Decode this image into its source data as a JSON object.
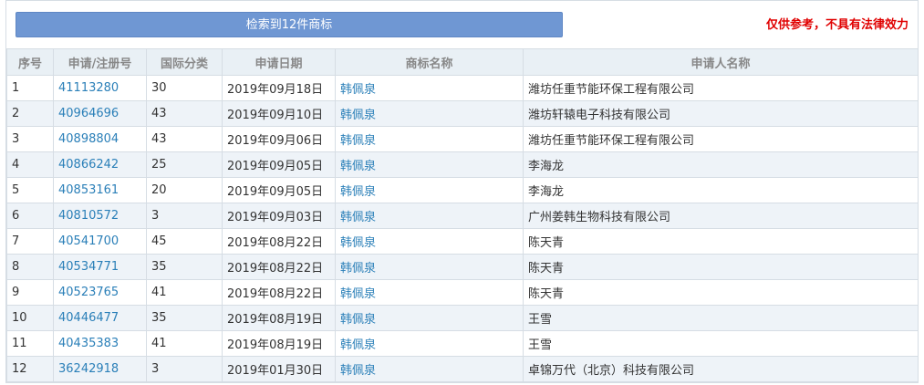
{
  "header": {
    "result_button_label": "检索到12件商标",
    "disclaimer": "仅供参考，不具有法律效力"
  },
  "table": {
    "columns": [
      "序号",
      "申请/注册号",
      "国际分类",
      "申请日期",
      "商标名称",
      "申请人名称"
    ],
    "rows": [
      {
        "index": "1",
        "reg_no": "41113280",
        "class": "30",
        "date": "2019年09月18日",
        "mark": "韩佩泉",
        "applicant": "潍坊任重节能环保工程有限公司"
      },
      {
        "index": "2",
        "reg_no": "40964696",
        "class": "43",
        "date": "2019年09月10日",
        "mark": "韩佩泉",
        "applicant": "潍坊轩辕电子科技有限公司"
      },
      {
        "index": "3",
        "reg_no": "40898804",
        "class": "43",
        "date": "2019年09月06日",
        "mark": "韩佩泉",
        "applicant": "潍坊任重节能环保工程有限公司"
      },
      {
        "index": "4",
        "reg_no": "40866242",
        "class": "25",
        "date": "2019年09月05日",
        "mark": "韩佩泉",
        "applicant": "李海龙"
      },
      {
        "index": "5",
        "reg_no": "40853161",
        "class": "20",
        "date": "2019年09月05日",
        "mark": "韩佩泉",
        "applicant": "李海龙"
      },
      {
        "index": "6",
        "reg_no": "40810572",
        "class": "3",
        "date": "2019年09月03日",
        "mark": "韩佩泉",
        "applicant": "广州姜韩生物科技有限公司"
      },
      {
        "index": "7",
        "reg_no": "40541700",
        "class": "45",
        "date": "2019年08月22日",
        "mark": "韩佩泉",
        "applicant": "陈天青"
      },
      {
        "index": "8",
        "reg_no": "40534771",
        "class": "35",
        "date": "2019年08月22日",
        "mark": "韩佩泉",
        "applicant": "陈天青"
      },
      {
        "index": "9",
        "reg_no": "40523765",
        "class": "41",
        "date": "2019年08月22日",
        "mark": "韩佩泉",
        "applicant": "陈天青"
      },
      {
        "index": "10",
        "reg_no": "40446477",
        "class": "35",
        "date": "2019年08月19日",
        "mark": "韩佩泉",
        "applicant": "王雪"
      },
      {
        "index": "11",
        "reg_no": "40435383",
        "class": "41",
        "date": "2019年08月19日",
        "mark": "韩佩泉",
        "applicant": "王雪"
      },
      {
        "index": "12",
        "reg_no": "36242918",
        "class": "3",
        "date": "2019年01月30日",
        "mark": "韩佩泉",
        "applicant": "卓锦万代（北京）科技有限公司"
      }
    ]
  },
  "colors": {
    "button_bg": "#6f97d3",
    "disclaimer": "#e00000",
    "link": "#2a7fb8",
    "header_bg": "#e9f0f5",
    "stripe_bg": "#eef3f8"
  }
}
